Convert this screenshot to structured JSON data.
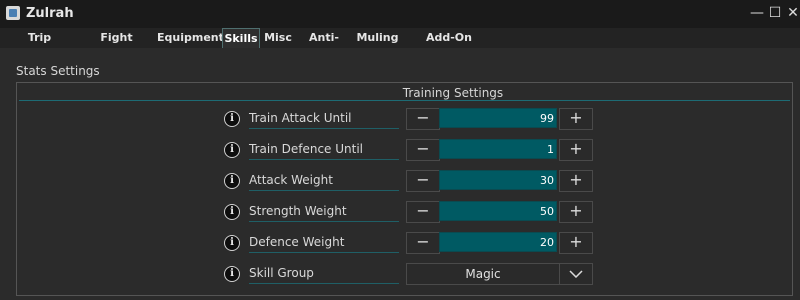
{
  "window": {
    "title": "Zulrah",
    "minimize_icon": "minimize-icon",
    "maximize_icon": "maximize-icon",
    "close_icon": "close-icon"
  },
  "menu": {
    "tabs": [
      {
        "label": "Trip Settings"
      },
      {
        "label": "Fight Settings"
      },
      {
        "label": "Equipment"
      },
      {
        "label": "Skills",
        "active": true
      },
      {
        "label": "Misc"
      },
      {
        "label": "Anti-ban"
      },
      {
        "label": "Muling"
      },
      {
        "label": "Add-On Settings"
      }
    ]
  },
  "stats": {
    "section_label": "Stats Settings",
    "panel_title": "Training Settings",
    "rows": [
      {
        "label": "Train Attack Until",
        "value": "99"
      },
      {
        "label": "Train Defence Until",
        "value": "1"
      },
      {
        "label": "Attack Weight",
        "value": "30"
      },
      {
        "label": "Strength Weight",
        "value": "50"
      },
      {
        "label": "Defence Weight",
        "value": "20"
      }
    ],
    "skill_group": {
      "label": "Skill Group",
      "value": "Magic"
    }
  },
  "colors": {
    "accent": "#005a63",
    "background": "#2b2b2b",
    "titlebar": "#1a1a1a"
  }
}
